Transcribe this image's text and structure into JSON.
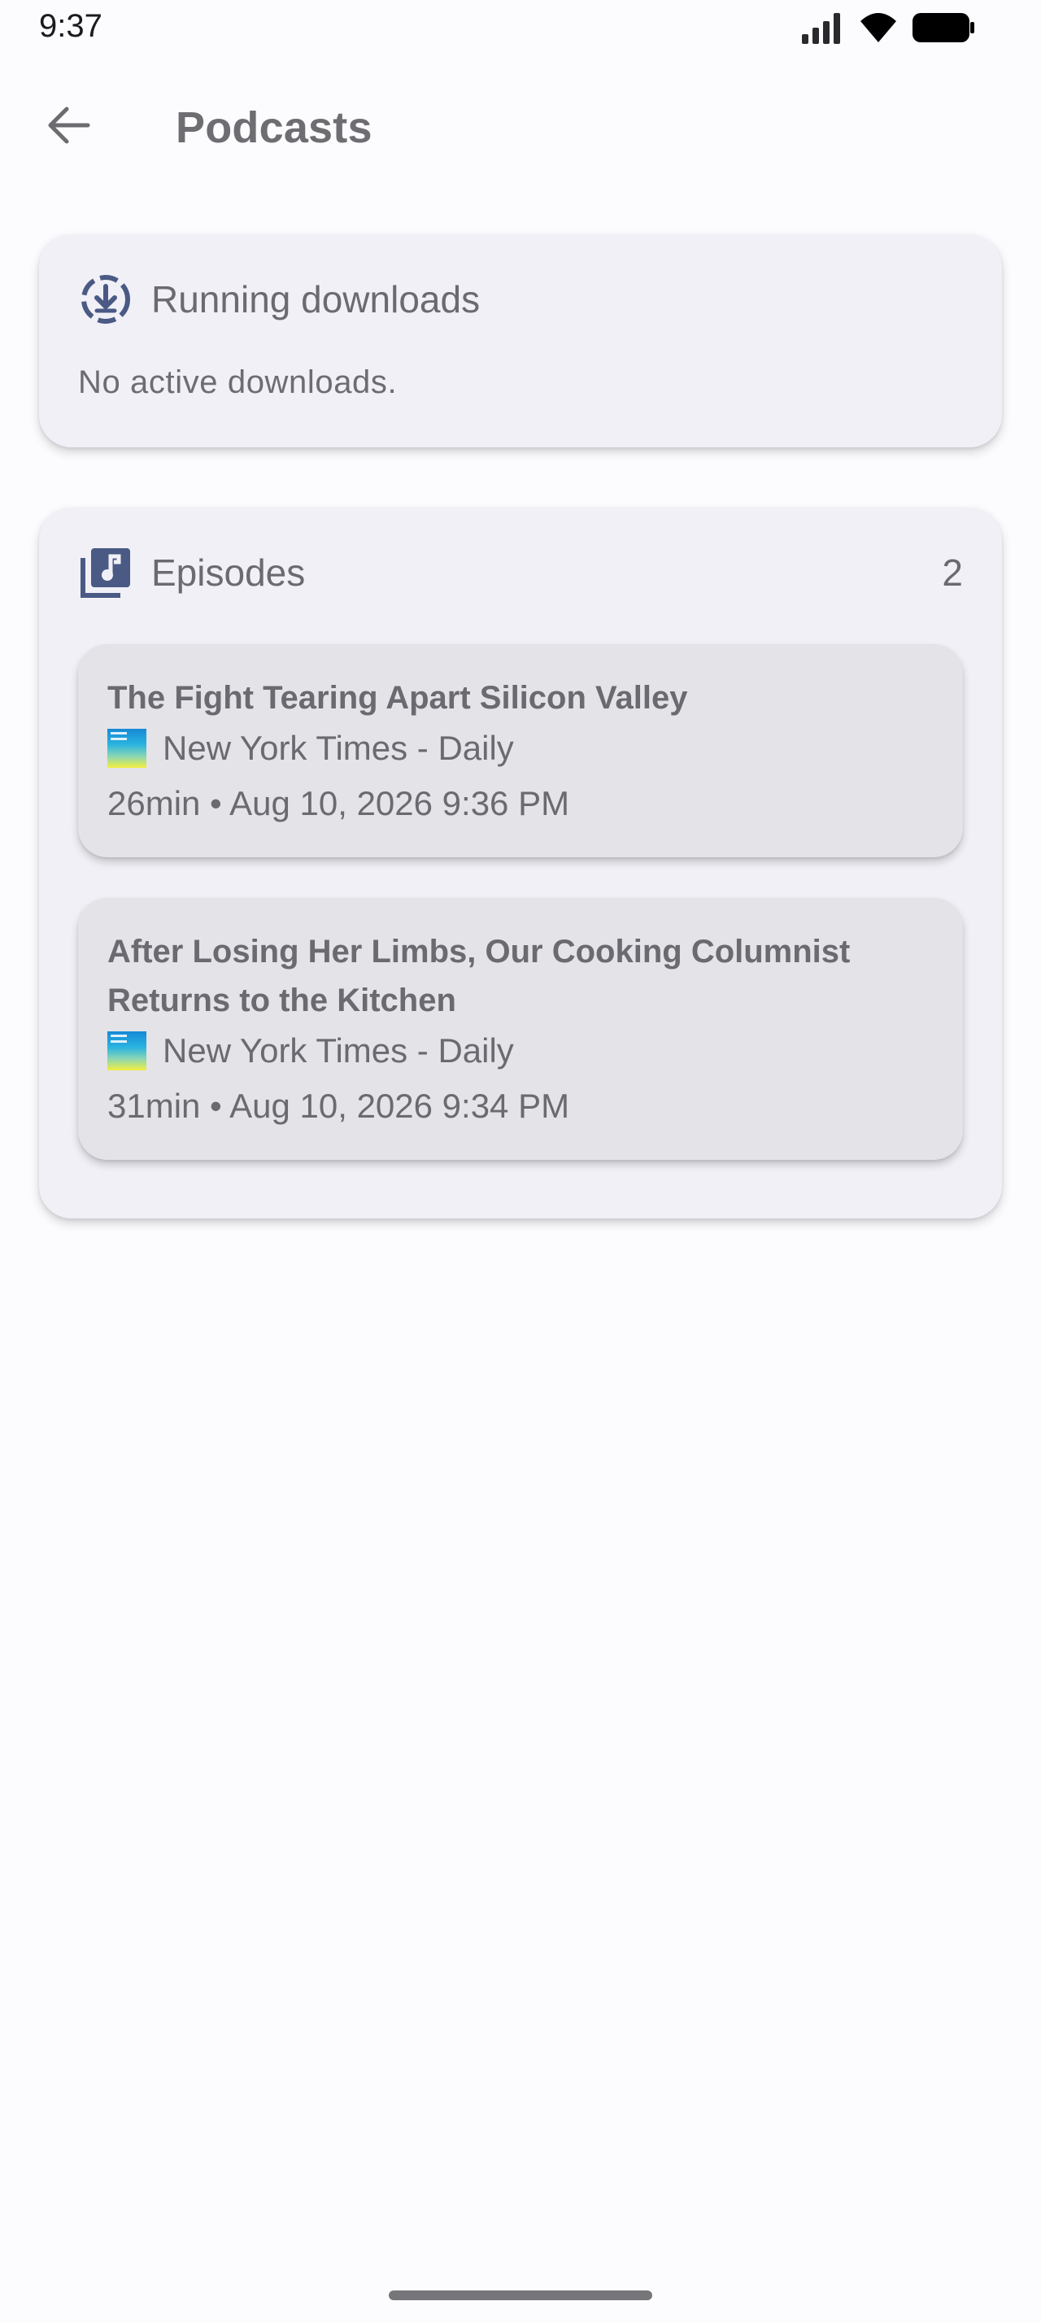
{
  "status_bar": {
    "time": "9:37",
    "icons": [
      "signal-icon",
      "wifi-icon",
      "battery-icon"
    ]
  },
  "app_bar": {
    "back_icon": "arrow-back-icon",
    "title": "Podcasts"
  },
  "downloads": {
    "icon": "download-progress-icon",
    "title": "Running downloads",
    "empty_text": "No active downloads."
  },
  "episodes": {
    "icon": "music-library-icon",
    "title": "Episodes",
    "count": "2",
    "items": [
      {
        "title": "The Fight Tearing Apart Silicon Valley",
        "podcast": "New York Times - Daily",
        "info": "26min • Aug 10, 2026 9:36 PM"
      },
      {
        "title": "After Losing Her Limbs, Our Cooking Columnist Returns to the Kitchen",
        "podcast": "New York Times - Daily",
        "info": "31min • Aug 10, 2026 9:34 PM"
      }
    ]
  },
  "colors": {
    "background": "#fcfbfe",
    "card": "#f1f0f6",
    "episode_card": "#e4e3e8",
    "icon_accent": "#4a5a85",
    "text": "#6a6a70"
  }
}
